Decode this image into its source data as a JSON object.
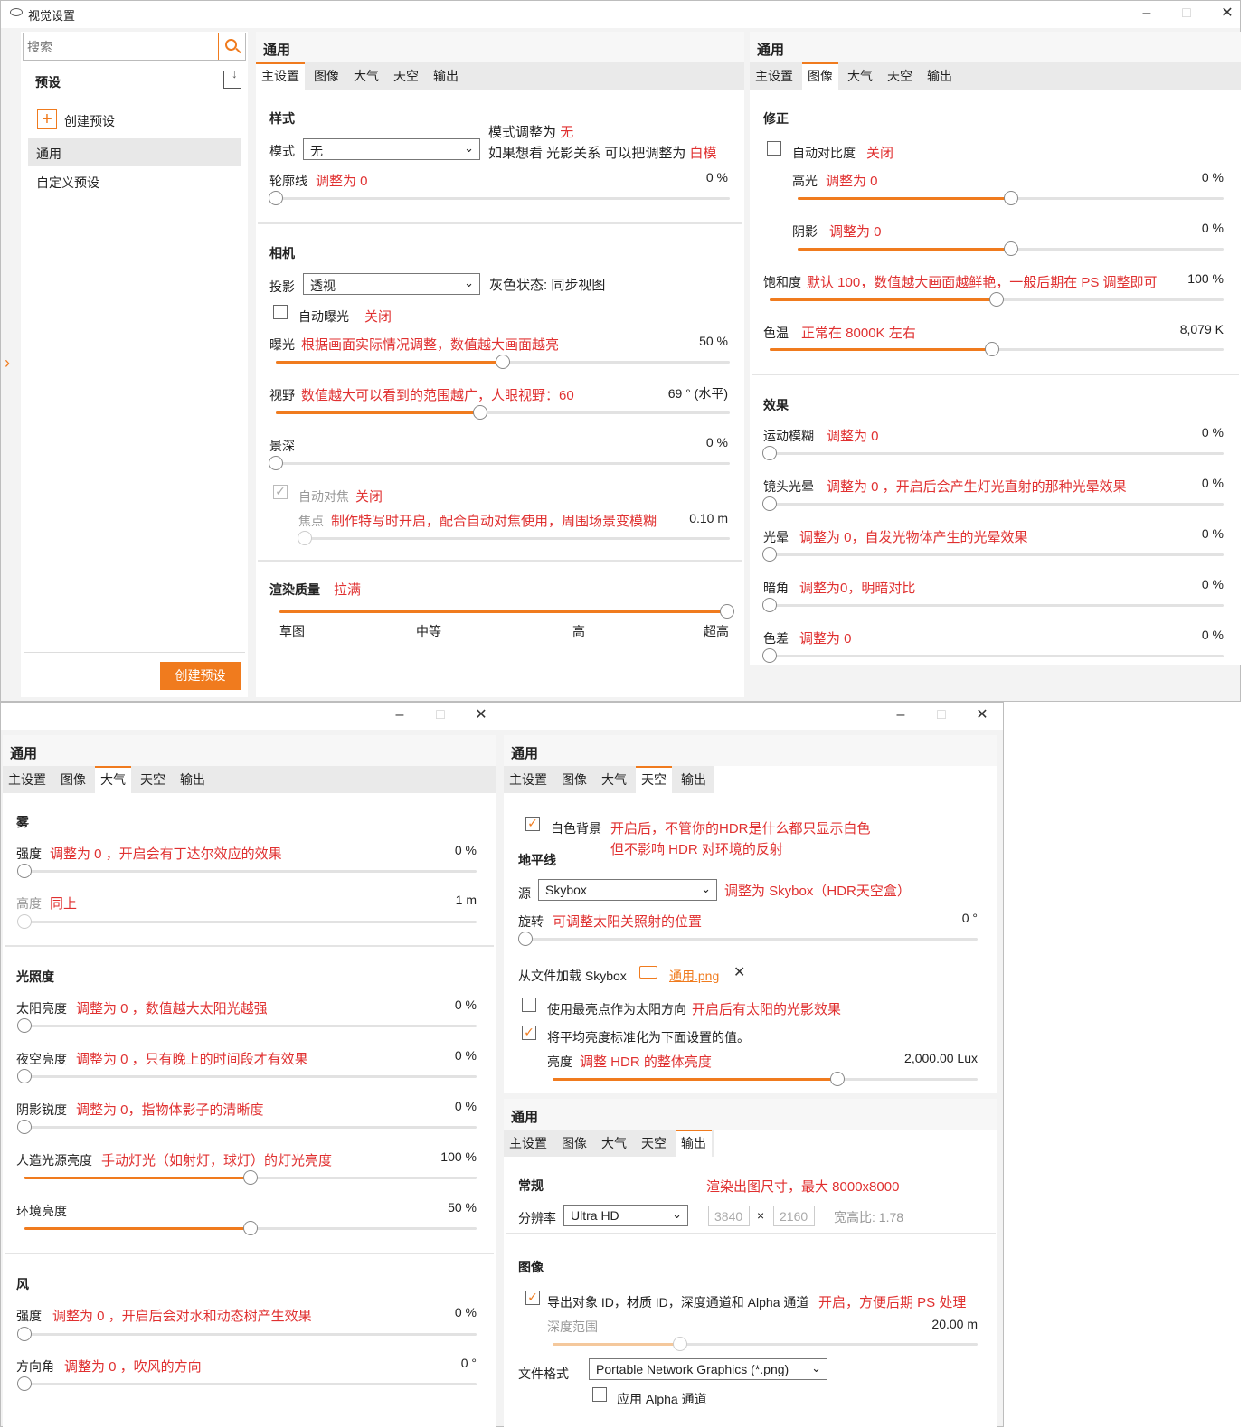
{
  "app": {
    "title": "视觉设置"
  },
  "sidebar": {
    "search_placeholder": "搜索",
    "presets_title": "预设",
    "create_preset": "创建预设",
    "items": [
      "通用",
      "自定义预设"
    ],
    "create_button": "创建预设"
  },
  "general_title": "通用",
  "tabs": [
    "主设置",
    "图像",
    "大气",
    "天空",
    "输出"
  ],
  "main": {
    "style": {
      "title": "样式",
      "mode_label": "模式",
      "mode_value": "无",
      "note1_prefix": "模式调整为",
      "note1_value": "无",
      "note2_prefix": "如果想看 光影关系 可以把调整为",
      "note2_value": "白模",
      "outline_label": "轮廓线",
      "outline_note": "调整为 0",
      "outline_value": "0 %",
      "outline_level": 0
    },
    "camera": {
      "title": "相机",
      "proj_label": "投影",
      "proj_value": "透视",
      "grey_state": "灰色状态: 同步视图",
      "auto_exposure": "自动曝光",
      "auto_exposure_note": "关闭",
      "exposure_label": "曝光",
      "exposure_note": "根据画面实际情况调整，数值越大画面越亮",
      "exposure_value": "50 %",
      "exposure_level": 0.5,
      "fov_label": "视野",
      "fov_note": "数值越大可以看到的范围越广，人眼视野：60",
      "fov_value": "69 ° (水平)",
      "fov_level": 0.45,
      "dof_label": "景深",
      "dof_value": "0 %",
      "dof_level": 0,
      "autofocus": "自动对焦",
      "autofocus_note": "关闭",
      "focus_label": "焦点",
      "focus_note": "制作特写时开启，配合自动对焦使用，周围场景变模糊",
      "focus_value": "0.10 m",
      "focus_level": 0
    },
    "render": {
      "title": "渲染质量",
      "note": "拉满",
      "level": 1.0,
      "ticks": [
        "草图",
        "中等",
        "高",
        "超高"
      ]
    }
  },
  "image": {
    "correction": {
      "title": "修正",
      "auto_contrast": "自动对比度",
      "auto_contrast_note": "关闭",
      "highlight_label": "高光",
      "highlight_note": "调整为 0",
      "highlight_value": "0 %",
      "highlight_level": 0.5,
      "shadow_label": "阴影",
      "shadow_note": "调整为 0",
      "shadow_value": "0 %",
      "shadow_level": 0.5,
      "saturation_label": "饱和度",
      "saturation_note": "默认 100，数值越大画面越鲜艳，一般后期在 PS 调整即可",
      "saturation_value": "100 %",
      "saturation_level": 0.5,
      "temp_label": "色温",
      "temp_note": "正常在 8000K 左右",
      "temp_value": "8,079 K",
      "temp_level": 0.49
    },
    "effects": {
      "title": "效果",
      "items": [
        {
          "label": "运动模糊",
          "note": "调整为 0",
          "value": "0 %",
          "level": 0
        },
        {
          "label": "镜头光晕",
          "note": "调整为 0 ，开启后会产生灯光直射的那种光晕效果",
          "value": "0 %",
          "level": 0
        },
        {
          "label": "光晕",
          "note": "调整为 0，自发光物体产生的光晕效果",
          "value": "0 %",
          "level": 0
        },
        {
          "label": "暗角",
          "note": "调整为0，明暗对比",
          "value": "0 %",
          "level": 0
        },
        {
          "label": "色差",
          "note": "调整为 0",
          "value": "0 %",
          "level": 0
        }
      ]
    }
  },
  "atmos": {
    "fog": {
      "title": "雾",
      "strength_label": "强度",
      "strength_note": "调整为 0 ，开启会有丁达尔效应的效果",
      "strength_value": "0 %",
      "strength_level": 0,
      "height_label": "高度",
      "height_note": "同上",
      "height_value": "1 m",
      "height_level": 0
    },
    "light": {
      "title": "光照度",
      "items": [
        {
          "label": "太阳亮度",
          "note": "调整为 0 ，数值越大太阳光越强",
          "value": "0 %",
          "level": 0
        },
        {
          "label": "夜空亮度",
          "note": "调整为 0 ，只有晚上的时间段才有效果",
          "value": "0 %",
          "level": 0
        },
        {
          "label": "阴影锐度",
          "note": "调整为 0，指物体影子的清晰度",
          "value": "0 %",
          "level": 0
        },
        {
          "label": "人造光源亮度",
          "note": "手动灯光（如射灯，球灯）的灯光亮度",
          "value": "100 %",
          "level": 0.5
        },
        {
          "label": "环境亮度",
          "note": "",
          "value": "50 %",
          "level": 0.5
        }
      ]
    },
    "wind": {
      "title": "风",
      "strength_label": "强度",
      "strength_note": "调整为 0 ，开启后会对水和动态树产生效果",
      "strength_value": "0 %",
      "strength_level": 0,
      "dir_label": "方向角",
      "dir_note": "调整为 0 ，吹风的方向",
      "dir_value": "0 °",
      "dir_level": 0
    }
  },
  "sky": {
    "white_bg": "白色背景",
    "white_bg_note1": "开启后，不管你的HDR是什么都只显示白色",
    "white_bg_note2": "但不影响 HDR 对环境的反射",
    "horizon_title": "地平线",
    "source_label": "源",
    "source_value": "Skybox",
    "source_note": "调整为 Skybox（HDR天空盒）",
    "rotation_label": "旋转",
    "rotation_note": "可调整太阳关照射的位置",
    "rotation_value": "0 °",
    "rotation_level": 0,
    "load_label": "从文件加载 Skybox",
    "file_name": "通用.png",
    "brightest_label": "使用最亮点作为太阳方向",
    "brightest_note": "开启后有太阳的光影效果",
    "normalize_label": "将平均亮度标准化为下面设置的值。",
    "brightness_label": "亮度",
    "brightness_note": "调整 HDR 的整体亮度",
    "brightness_value": "2,000.00 Lux",
    "brightness_level": 0.67
  },
  "output": {
    "general_title": "常规",
    "size_note": "渲染出图尺寸，最大 8000x8000",
    "res_label": "分辨率",
    "res_value": "Ultra HD",
    "width": "3840",
    "x_sep": "×",
    "height": "2160",
    "aspect": "宽高比: 1.78",
    "image_title": "图像",
    "export_ids": "导出对象 ID，材质 ID，深度通道和 Alpha 通道",
    "export_note": "开启，方便后期 PS 处理",
    "depth_label": "深度范围",
    "depth_value": "20.00 m",
    "depth_level": 0.3,
    "format_label": "文件格式",
    "format_value": "Portable Network Graphics (*.png)",
    "alpha_label": "应用 Alpha 通道"
  },
  "icons": {
    "app": "eye-icon",
    "search": "search-icon",
    "export": "export-icon",
    "plus": "plus-icon",
    "folder": "folder-icon",
    "close": "close-icon",
    "chevron": "chevron-down-icon",
    "expand": "chevron-right-icon"
  },
  "colors": {
    "accent": "#f07b1e",
    "note": "#e03030"
  }
}
